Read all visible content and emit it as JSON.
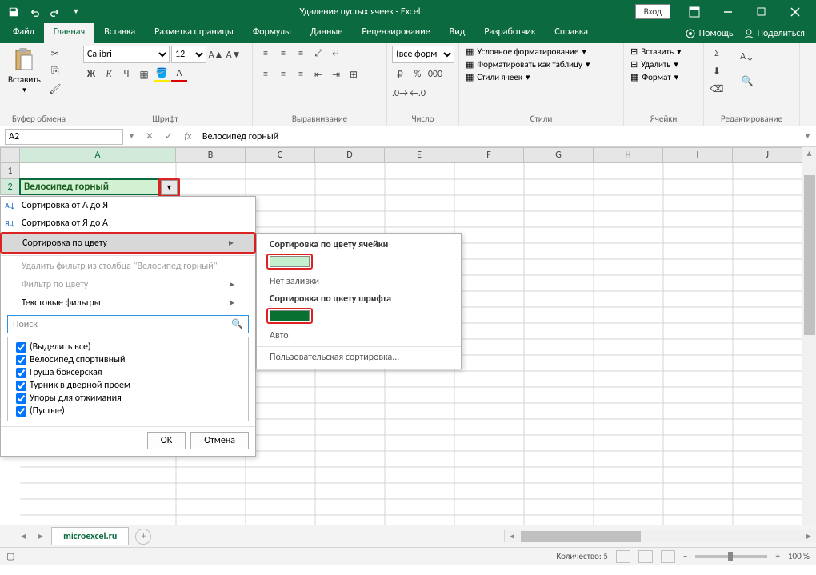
{
  "title": "Удаление пустых ячеек  -  Excel",
  "login": "Вход",
  "tabs": [
    "Файл",
    "Главная",
    "Вставка",
    "Разметка страницы",
    "Формулы",
    "Данные",
    "Рецензирование",
    "Вид",
    "Разработчик",
    "Справка"
  ],
  "tell_me": "Помощь",
  "share": "Поделиться",
  "ribbon": {
    "clipboard": {
      "paste": "Вставить",
      "label": "Буфер обмена"
    },
    "font": {
      "name": "Calibri",
      "size": "12",
      "label": "Шрифт",
      "bold": "Ж",
      "italic": "К",
      "underline": "Ч"
    },
    "alignment": {
      "label": "Выравнивание"
    },
    "number": {
      "format": "(все форм",
      "label": "Число"
    },
    "styles": {
      "cond": "Условное форматирование",
      "table": "Форматировать как таблицу",
      "cell": "Стили ячеек",
      "label": "Стили"
    },
    "cells": {
      "insert": "Вставить",
      "delete": "Удалить",
      "format": "Формат",
      "label": "Ячейки"
    },
    "editing": {
      "label": "Редактирование"
    }
  },
  "formula_bar": {
    "name_box": "A2",
    "formula": "Велосипед горный"
  },
  "columns": [
    "A",
    "B",
    "C",
    "D",
    "E",
    "F",
    "G",
    "H",
    "I",
    "J"
  ],
  "rows": [
    "1",
    "2"
  ],
  "active_cell_text": "Велосипед горный",
  "filter_menu": {
    "sort_az": "Сортировка от А до Я",
    "sort_za": "Сортировка от Я до А",
    "sort_color": "Сортировка по цвету",
    "clear_filter": "Удалить фильтр из столбца \"Велосипед горный\"",
    "filter_color": "Фильтр по цвету",
    "text_filters": "Текстовые фильтры",
    "search_placeholder": "Поиск",
    "items": [
      "(Выделить все)",
      "Велосипед спортивный",
      "Груша боксерская",
      "Турник в дверной проем",
      "Упоры для отжимания",
      "(Пустые)"
    ],
    "ok": "ОК",
    "cancel": "Отмена"
  },
  "submenu": {
    "by_cell_color": "Сортировка по цвету ячейки",
    "no_fill": "Нет заливки",
    "by_font_color": "Сортировка по цвету шрифта",
    "auto": "Авто",
    "custom": "Пользовательская сортировка..."
  },
  "sheet_tab": "microexcel.ru",
  "statusbar": {
    "count_label": "Количество:",
    "count": "5",
    "zoom": "100 %"
  }
}
